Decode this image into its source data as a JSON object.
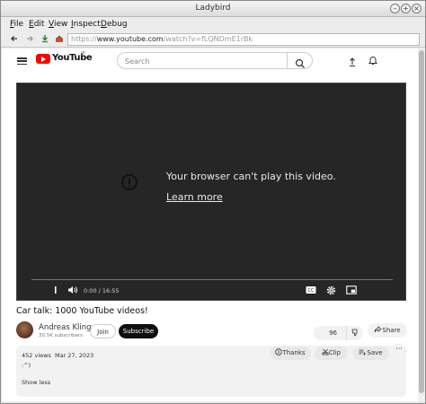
{
  "window": {
    "title": "Ladybird",
    "controls": [
      "minimize",
      "maximize",
      "close"
    ]
  },
  "menu": [
    "File",
    "Edit",
    "View",
    "Inspect",
    "Debug"
  ],
  "toolbar": {
    "url_host": "www.youtube.com",
    "url_scheme": "https://",
    "url_path": "/watch?v=fLQNDmE1rBk",
    "icons": [
      "back-icon",
      "forward-icon",
      "reload-icon",
      "home-icon"
    ]
  },
  "youtube": {
    "logo_text": "YouTube",
    "country_code": "JP",
    "search_placeholder": "Search",
    "player": {
      "error_message": "Your browser can't play this video.",
      "learn_more": "Learn more",
      "time": "0:00 / 16:55",
      "progress": 0
    },
    "video": {
      "title": "Car talk: 1000 YouTube videos!",
      "channel": "Andreas Kling",
      "subscribers": "30.5K subscribers",
      "join_label": "Join",
      "subscribe_label": "Subscribe",
      "likes": "96",
      "share_label": "Share",
      "thanks_label": "Thanks",
      "clip_label": "Clip",
      "save_label": "Save",
      "views": "452 views",
      "date": "Mar 27, 2023",
      "description": ":^)",
      "show_less": "Show less"
    }
  },
  "colors": {
    "brand_red": "#ff0000",
    "player_bg": "#262626",
    "subscribe_bg": "#0f0f0f"
  }
}
